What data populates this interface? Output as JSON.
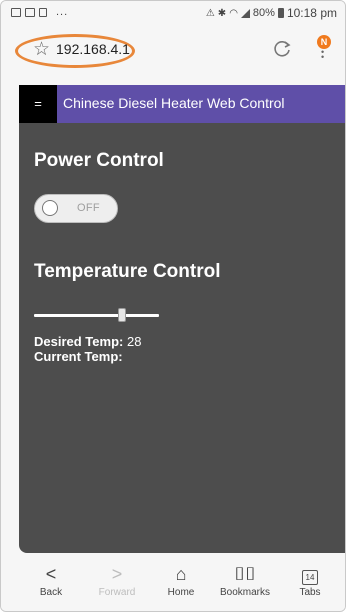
{
  "status_bar": {
    "dots": "...",
    "battery": "80%",
    "time": "10:18 pm"
  },
  "address_bar": {
    "url": "192.168.4.1",
    "notification_badge": "N"
  },
  "site": {
    "menu_toggle": "=",
    "title": "Chinese Diesel Heater Web Control",
    "header_color": "#5f4fa8",
    "background_color": "#4d4d4d"
  },
  "power": {
    "heading": "Power Control",
    "toggle_label": "OFF",
    "toggle_on": false
  },
  "temperature": {
    "heading": "Temperature Control",
    "slider_fraction": 0.7,
    "desired_label": "Desired Temp:",
    "desired_value": "28",
    "current_label": "Current Temp:",
    "current_value": ""
  },
  "bottom_nav": {
    "back": "Back",
    "forward": "Forward",
    "home": "Home",
    "bookmarks": "Bookmarks",
    "tabs": "Tabs",
    "tabs_count": "14"
  },
  "accent_color": "#e8873a"
}
